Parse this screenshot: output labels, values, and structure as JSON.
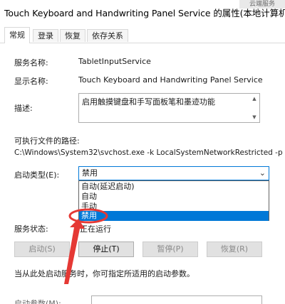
{
  "window": {
    "title": "Touch Keyboard and Handwriting Panel Service 的属性(本地计算机)",
    "bg_window_text": "云端服务"
  },
  "tabs": [
    {
      "label": "常规",
      "active": true
    },
    {
      "label": "登录",
      "active": false
    },
    {
      "label": "恢复",
      "active": false
    },
    {
      "label": "依存关系",
      "active": false
    }
  ],
  "general": {
    "service_name_label": "服务名称:",
    "service_name_value": "TabletInputService",
    "display_name_label": "显示名称:",
    "display_name_value": "Touch Keyboard and Handwriting Panel Service",
    "description_label": "描述:",
    "description_value": "启用触摸键盘和手写面板笔和墨迹功能",
    "exe_path_label": "可执行文件的路径:",
    "exe_path_value": "C:\\Windows\\System32\\svchost.exe -k LocalSystemNetworkRestricted -p",
    "startup_type_label": "启动类型(E):",
    "startup_type_selected": "禁用",
    "startup_options": [
      {
        "label": "自动(延迟启动)",
        "selected": false
      },
      {
        "label": "自动",
        "selected": false
      },
      {
        "label": "手动",
        "selected": false
      },
      {
        "label": "禁用",
        "selected": true
      }
    ],
    "service_status_label": "服务状态:",
    "service_status_value": "正在运行",
    "buttons": [
      {
        "label": "启动(S)",
        "enabled": false
      },
      {
        "label": "停止(T)",
        "enabled": true
      },
      {
        "label": "暂停(P)",
        "enabled": false
      },
      {
        "label": "恢复(R)",
        "enabled": false
      }
    ],
    "hint_text": "当从此处启动服务时，你可指定所适用的启动参数。",
    "start_params_label": "启动参数(M):"
  },
  "colors": {
    "accent": "#0078d7",
    "annotation": "#e53935",
    "close": "#e81123"
  }
}
